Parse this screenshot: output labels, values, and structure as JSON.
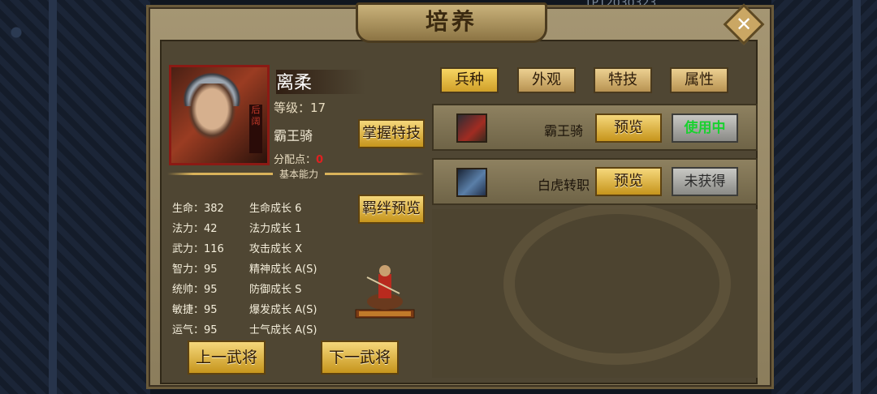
{
  "title": "培养",
  "background_text": "TP12030323",
  "close_label": "✕",
  "hero": {
    "name": "离柔",
    "level": "等级：17",
    "unit": "霸王骑",
    "points_label": "分配点：",
    "points_value": "0",
    "portrait_tag": "后阔"
  },
  "buttons": {
    "master_skill": "掌握特技",
    "bond_preview": "羁绊预览",
    "prev_general": "上一武将",
    "next_general": "下一武将"
  },
  "section_label": "基本能力",
  "stats": [
    {
      "label": "生命：",
      "value": "382",
      "growth_label": "生命成长",
      "growth_value": "6"
    },
    {
      "label": "法力：",
      "value": "42",
      "growth_label": "法力成长",
      "growth_value": "1"
    },
    {
      "label": "武力：",
      "value": "116",
      "growth_label": "攻击成长",
      "growth_value": "X"
    },
    {
      "label": "智力：",
      "value": "95",
      "growth_label": "精神成长",
      "growth_value": "A(S)"
    },
    {
      "label": "统帅：",
      "value": "95",
      "growth_label": "防御成长",
      "growth_value": "S"
    },
    {
      "label": "敏捷：",
      "value": "95",
      "growth_label": "爆发成长",
      "growth_value": "A(S)"
    },
    {
      "label": "运气：",
      "value": "95",
      "growth_label": "士气成长",
      "growth_value": "A(S)"
    }
  ],
  "tabs": [
    {
      "label": "兵种",
      "active": true
    },
    {
      "label": "外观",
      "active": false
    },
    {
      "label": "特技",
      "active": false
    },
    {
      "label": "属性",
      "active": false
    }
  ],
  "troops": [
    {
      "name": "霸王骑",
      "preview": "预览",
      "status": "使用中",
      "status_color": "#19d12f",
      "icon": "cavalry-unit-icon"
    },
    {
      "name": "白虎转职",
      "preview": "预览",
      "status": "未获得",
      "status_color": "#2a2a2a",
      "icon": "white-tiger-unit-icon"
    }
  ],
  "colors": {
    "accent_gold": "#d0a028",
    "points_red": "#e02020",
    "in_use_green": "#19d12f"
  }
}
